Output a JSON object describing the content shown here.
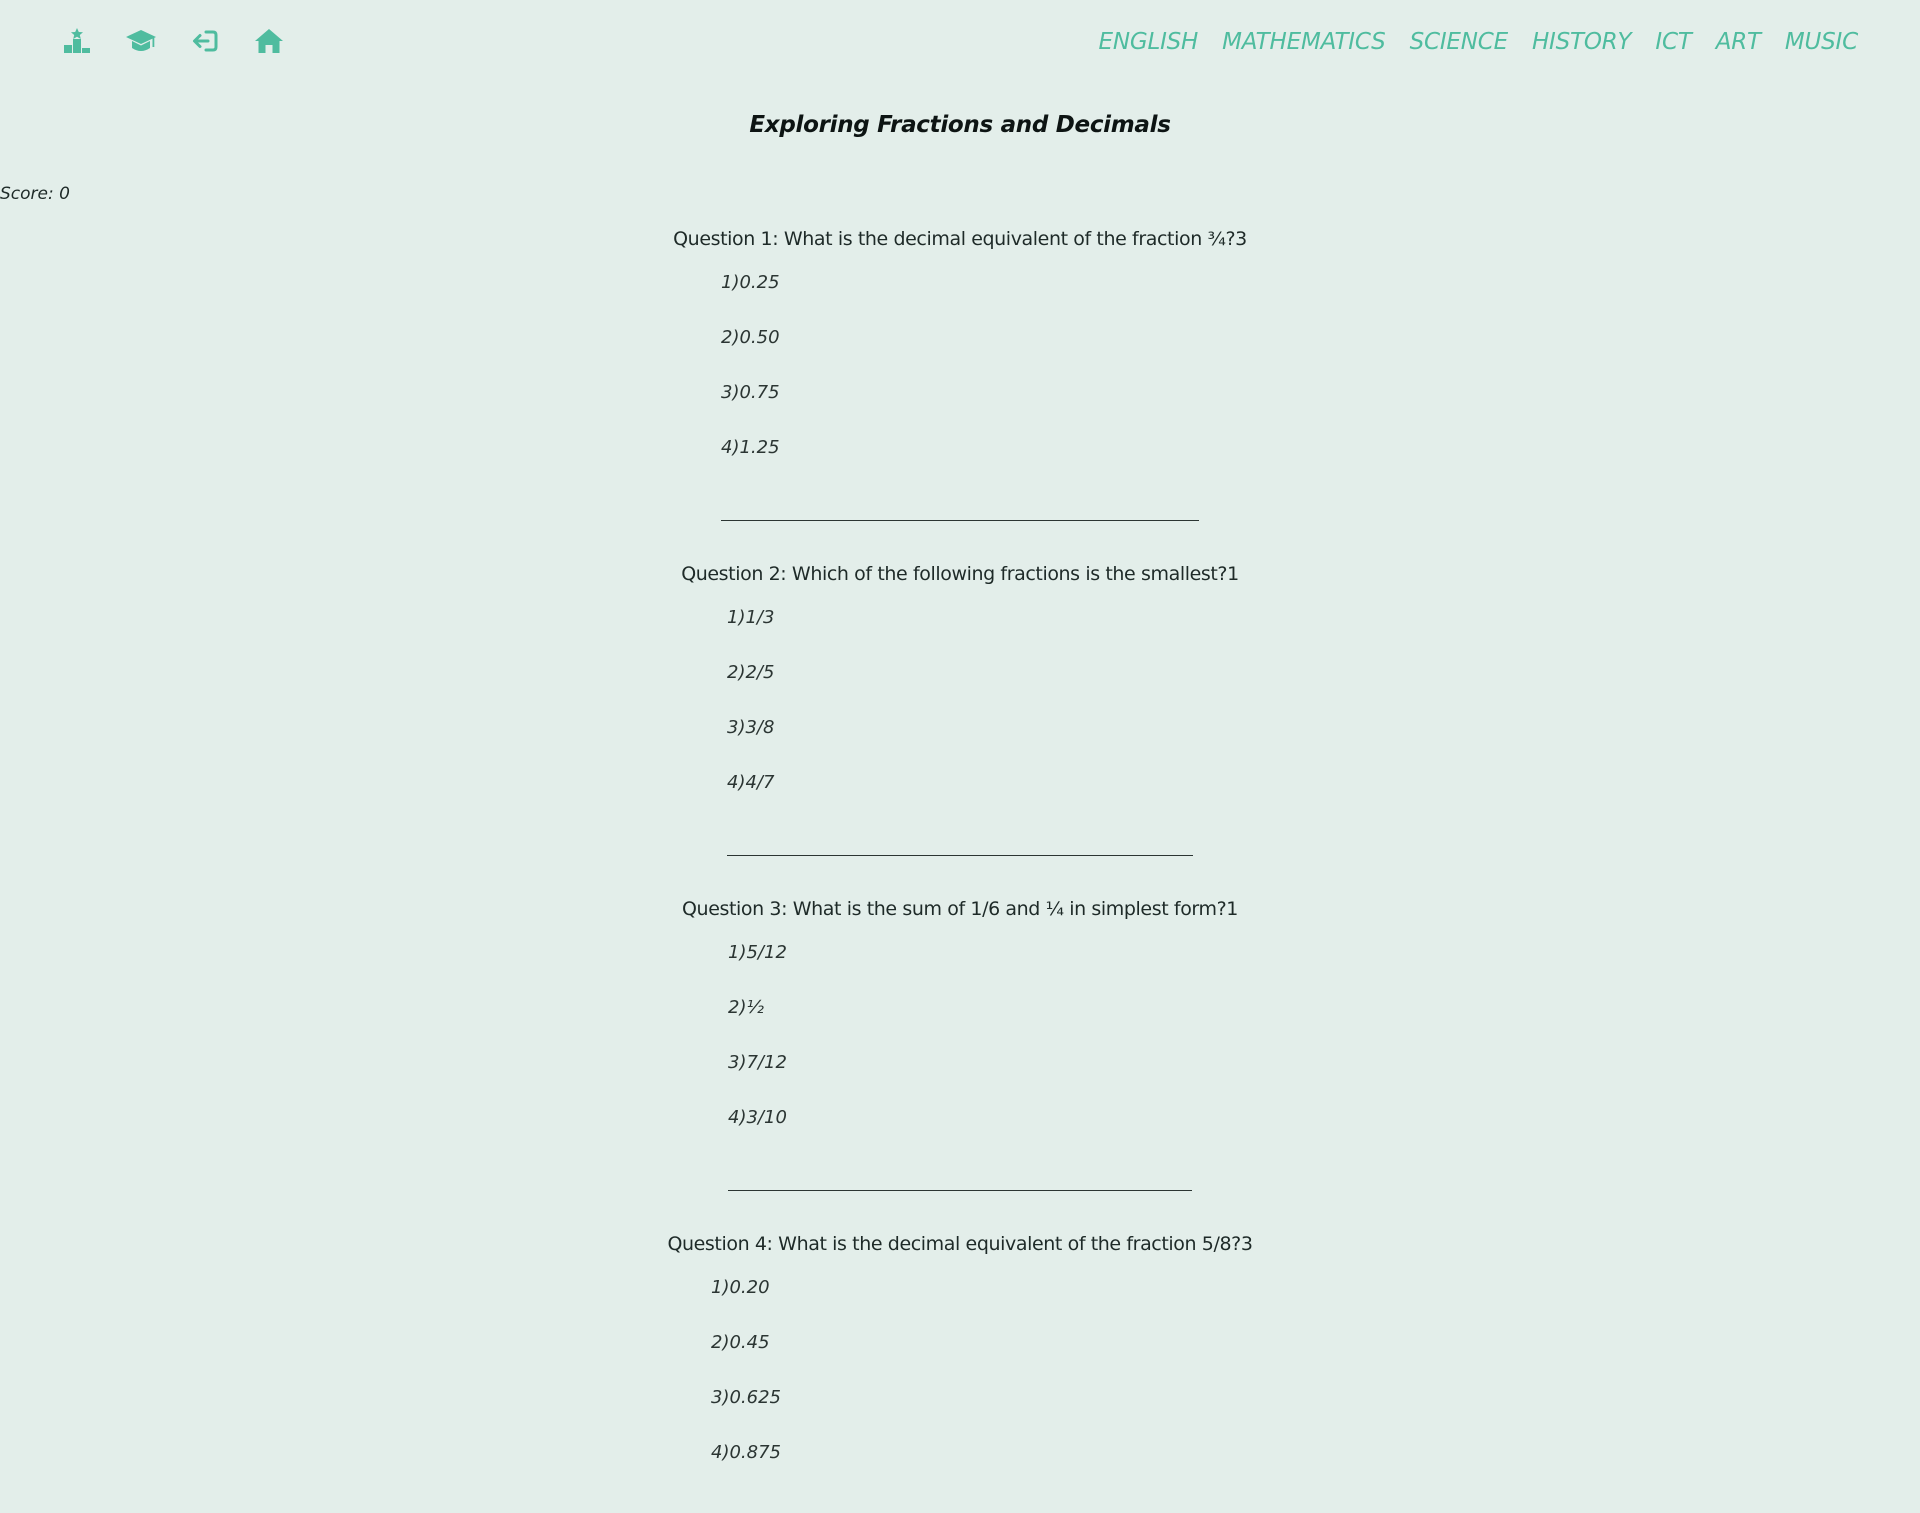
{
  "header": {
    "icons": [
      {
        "name": "leaderboard-icon"
      },
      {
        "name": "graduation-cap-icon"
      },
      {
        "name": "logout-icon"
      },
      {
        "name": "home-icon"
      }
    ],
    "nav": [
      "ENGLISH",
      "MATHEMATICS",
      "SCIENCE",
      "HISTORY",
      "ICT",
      "ART",
      "MUSIC"
    ],
    "accent_color": "#4fbc9f"
  },
  "quiz": {
    "title": "Exploring Fractions and Decimals",
    "score_label": "Score: 0",
    "questions": [
      {
        "text": "Question 1: What is the decimal equivalent of the fraction ¾?3",
        "options": [
          "1)0.25",
          "2)0.50",
          "3)0.75",
          "4)1.25"
        ]
      },
      {
        "text": "Question 2: Which of the following fractions is the smallest?1",
        "options": [
          "1)1/3",
          "2)2/5",
          "3)3/8",
          "4)4/7"
        ]
      },
      {
        "text": "Question 3: What is the sum of 1/6 and ¼ in simplest form?1",
        "options": [
          "1)5/12",
          "2)½",
          "3)7/12",
          "4)3/10"
        ]
      },
      {
        "text": "Question 4: What is the decimal equivalent of the fraction 5/8?3",
        "options": [
          "1)0.20",
          "2)0.45",
          "3)0.625",
          "4)0.875"
        ]
      }
    ]
  }
}
